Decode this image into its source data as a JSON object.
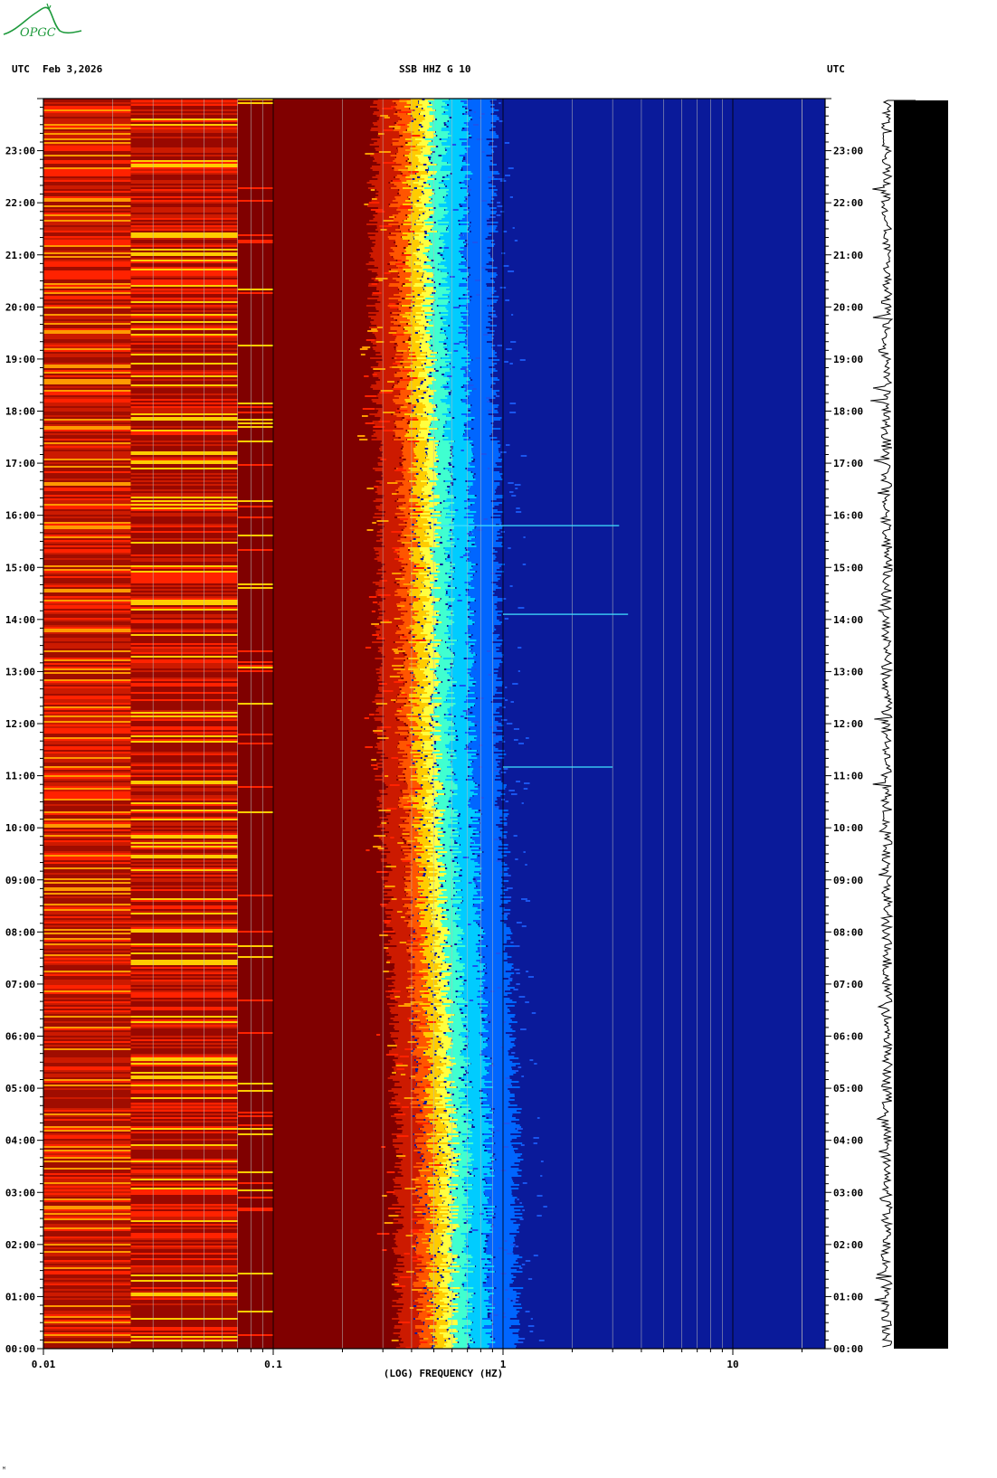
{
  "header": {
    "left_utc": "UTC",
    "date": "Feb 3,2026",
    "station": "SSB HHZ G 10",
    "right_utc": "UTC"
  },
  "logo": {
    "text": "OPGC",
    "color": "#1e9a3c"
  },
  "footer_mark": "ᴹ",
  "chart_data": {
    "type": "heatmap",
    "title": "SSB HHZ G 10",
    "xlabel": "(LOG) FREQUENCY (HZ)",
    "x_scale": "log",
    "xlim": [
      0.01,
      25
    ],
    "x_ticks": [
      {
        "value": 0.01,
        "label": "0.01"
      },
      {
        "value": 0.1,
        "label": "0.1"
      },
      {
        "value": 1,
        "label": "1"
      },
      {
        "value": 10,
        "label": "10"
      }
    ],
    "ylabel": "UTC",
    "ylim": [
      "00:00",
      "24:00"
    ],
    "y_ticks": [
      "00:00",
      "01:00",
      "02:00",
      "03:00",
      "04:00",
      "05:00",
      "06:00",
      "07:00",
      "08:00",
      "09:00",
      "10:00",
      "11:00",
      "12:00",
      "13:00",
      "14:00",
      "15:00",
      "16:00",
      "17:00",
      "18:00",
      "19:00",
      "20:00",
      "21:00",
      "22:00",
      "23:00"
    ],
    "colormap": [
      "#000080",
      "#0022cc",
      "#0066ff",
      "#00ccff",
      "#40ffd0",
      "#ffff00",
      "#ff9900",
      "#ff2200",
      "#cc1a00",
      "#800000"
    ],
    "band_power_by_hour": [
      {
        "hour": 0,
        "peak_edge_hz": 0.6
      },
      {
        "hour": 4,
        "peak_edge_hz": 0.6
      },
      {
        "hour": 8,
        "peak_edge_hz": 0.55
      },
      {
        "hour": 12,
        "peak_edge_hz": 0.5
      },
      {
        "hour": 16,
        "peak_edge_hz": 0.5
      },
      {
        "hour": 20,
        "peak_edge_hz": 0.47
      },
      {
        "hour": 24,
        "peak_edge_hz": 0.48
      }
    ],
    "events": [
      {
        "time": "15:48",
        "freq_range_hz": [
          0.5,
          3.2
        ]
      },
      {
        "time": "14:06",
        "freq_range_hz": [
          1.0,
          3.5
        ]
      },
      {
        "time": "11:10",
        "freq_range_hz": [
          1.0,
          3.0
        ]
      }
    ],
    "seismogram": "waveform trace on right side"
  }
}
